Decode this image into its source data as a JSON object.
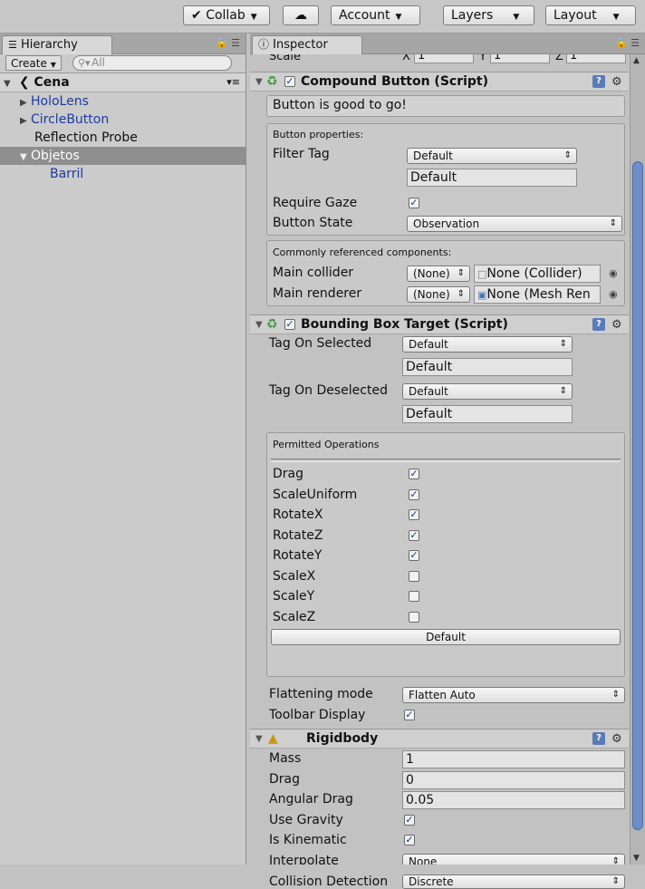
{
  "toolbar": {
    "collab": "Collab",
    "account": "Account",
    "layers": "Layers",
    "layout": "Layout"
  },
  "hierarchy": {
    "tab_label": "Hierarchy",
    "create_label": "Create",
    "search_placeholder": "All",
    "scene_name": "Cena",
    "items": [
      {
        "label": "HoloLens"
      },
      {
        "label": "CircleButton"
      },
      {
        "label": "Reflection Probe"
      },
      {
        "label": "Objetos"
      },
      {
        "label": "Barril"
      }
    ]
  },
  "inspector": {
    "tab_label": "Inspector",
    "scale_row": {
      "label": "Scale",
      "x_label": "X",
      "x": "1",
      "y_label": "Y",
      "y": "1",
      "z_label": "Z",
      "z": "1"
    },
    "compound_button": {
      "title": "Compound Button (Script)",
      "status": "Button is good to go!",
      "props_heading": "Button properties:",
      "filter_tag_label": "Filter Tag",
      "filter_tag_value": "Default",
      "filter_tag_text": "Default",
      "require_gaze_label": "Require Gaze",
      "button_state_label": "Button State",
      "button_state_value": "Observation",
      "components_heading": "Commonly referenced components:",
      "main_collider_label": "Main collider",
      "main_collider_sel": "(None)",
      "main_collider_value": "None (Collider)",
      "main_renderer_label": "Main renderer",
      "main_renderer_sel": "(None)",
      "main_renderer_value": "None (Mesh Ren"
    },
    "bounding_box": {
      "title": "Bounding Box Target (Script)",
      "tag_selected_label": "Tag On Selected",
      "tag_selected_value": "Default",
      "tag_selected_text": "Default",
      "tag_deselected_label": "Tag On Deselected",
      "tag_deselected_value": "Default",
      "tag_deselected_text": "Default",
      "permitted_heading": "Permitted Operations",
      "operations": [
        {
          "label": "Drag",
          "checked": true
        },
        {
          "label": "ScaleUniform",
          "checked": true
        },
        {
          "label": "RotateX",
          "checked": true
        },
        {
          "label": "RotateZ",
          "checked": true
        },
        {
          "label": "RotateY",
          "checked": true
        },
        {
          "label": "ScaleX",
          "checked": false
        },
        {
          "label": "ScaleY",
          "checked": false
        },
        {
          "label": "ScaleZ",
          "checked": false
        }
      ],
      "default_button": "Default",
      "flattening_label": "Flattening mode",
      "flattening_value": "Flatten Auto",
      "toolbar_display_label": "Toolbar Display"
    },
    "rigidbody": {
      "title": "Rigidbody",
      "mass_label": "Mass",
      "mass": "1",
      "drag_label": "Drag",
      "drag": "0",
      "angular_drag_label": "Angular Drag",
      "angular_drag": "0.05",
      "use_gravity_label": "Use Gravity",
      "is_kinematic_label": "Is Kinematic",
      "interpolate_label": "Interpolate",
      "interpolate_value": "None",
      "collision_label": "Collision Detection",
      "collision_value": "Discrete"
    }
  }
}
